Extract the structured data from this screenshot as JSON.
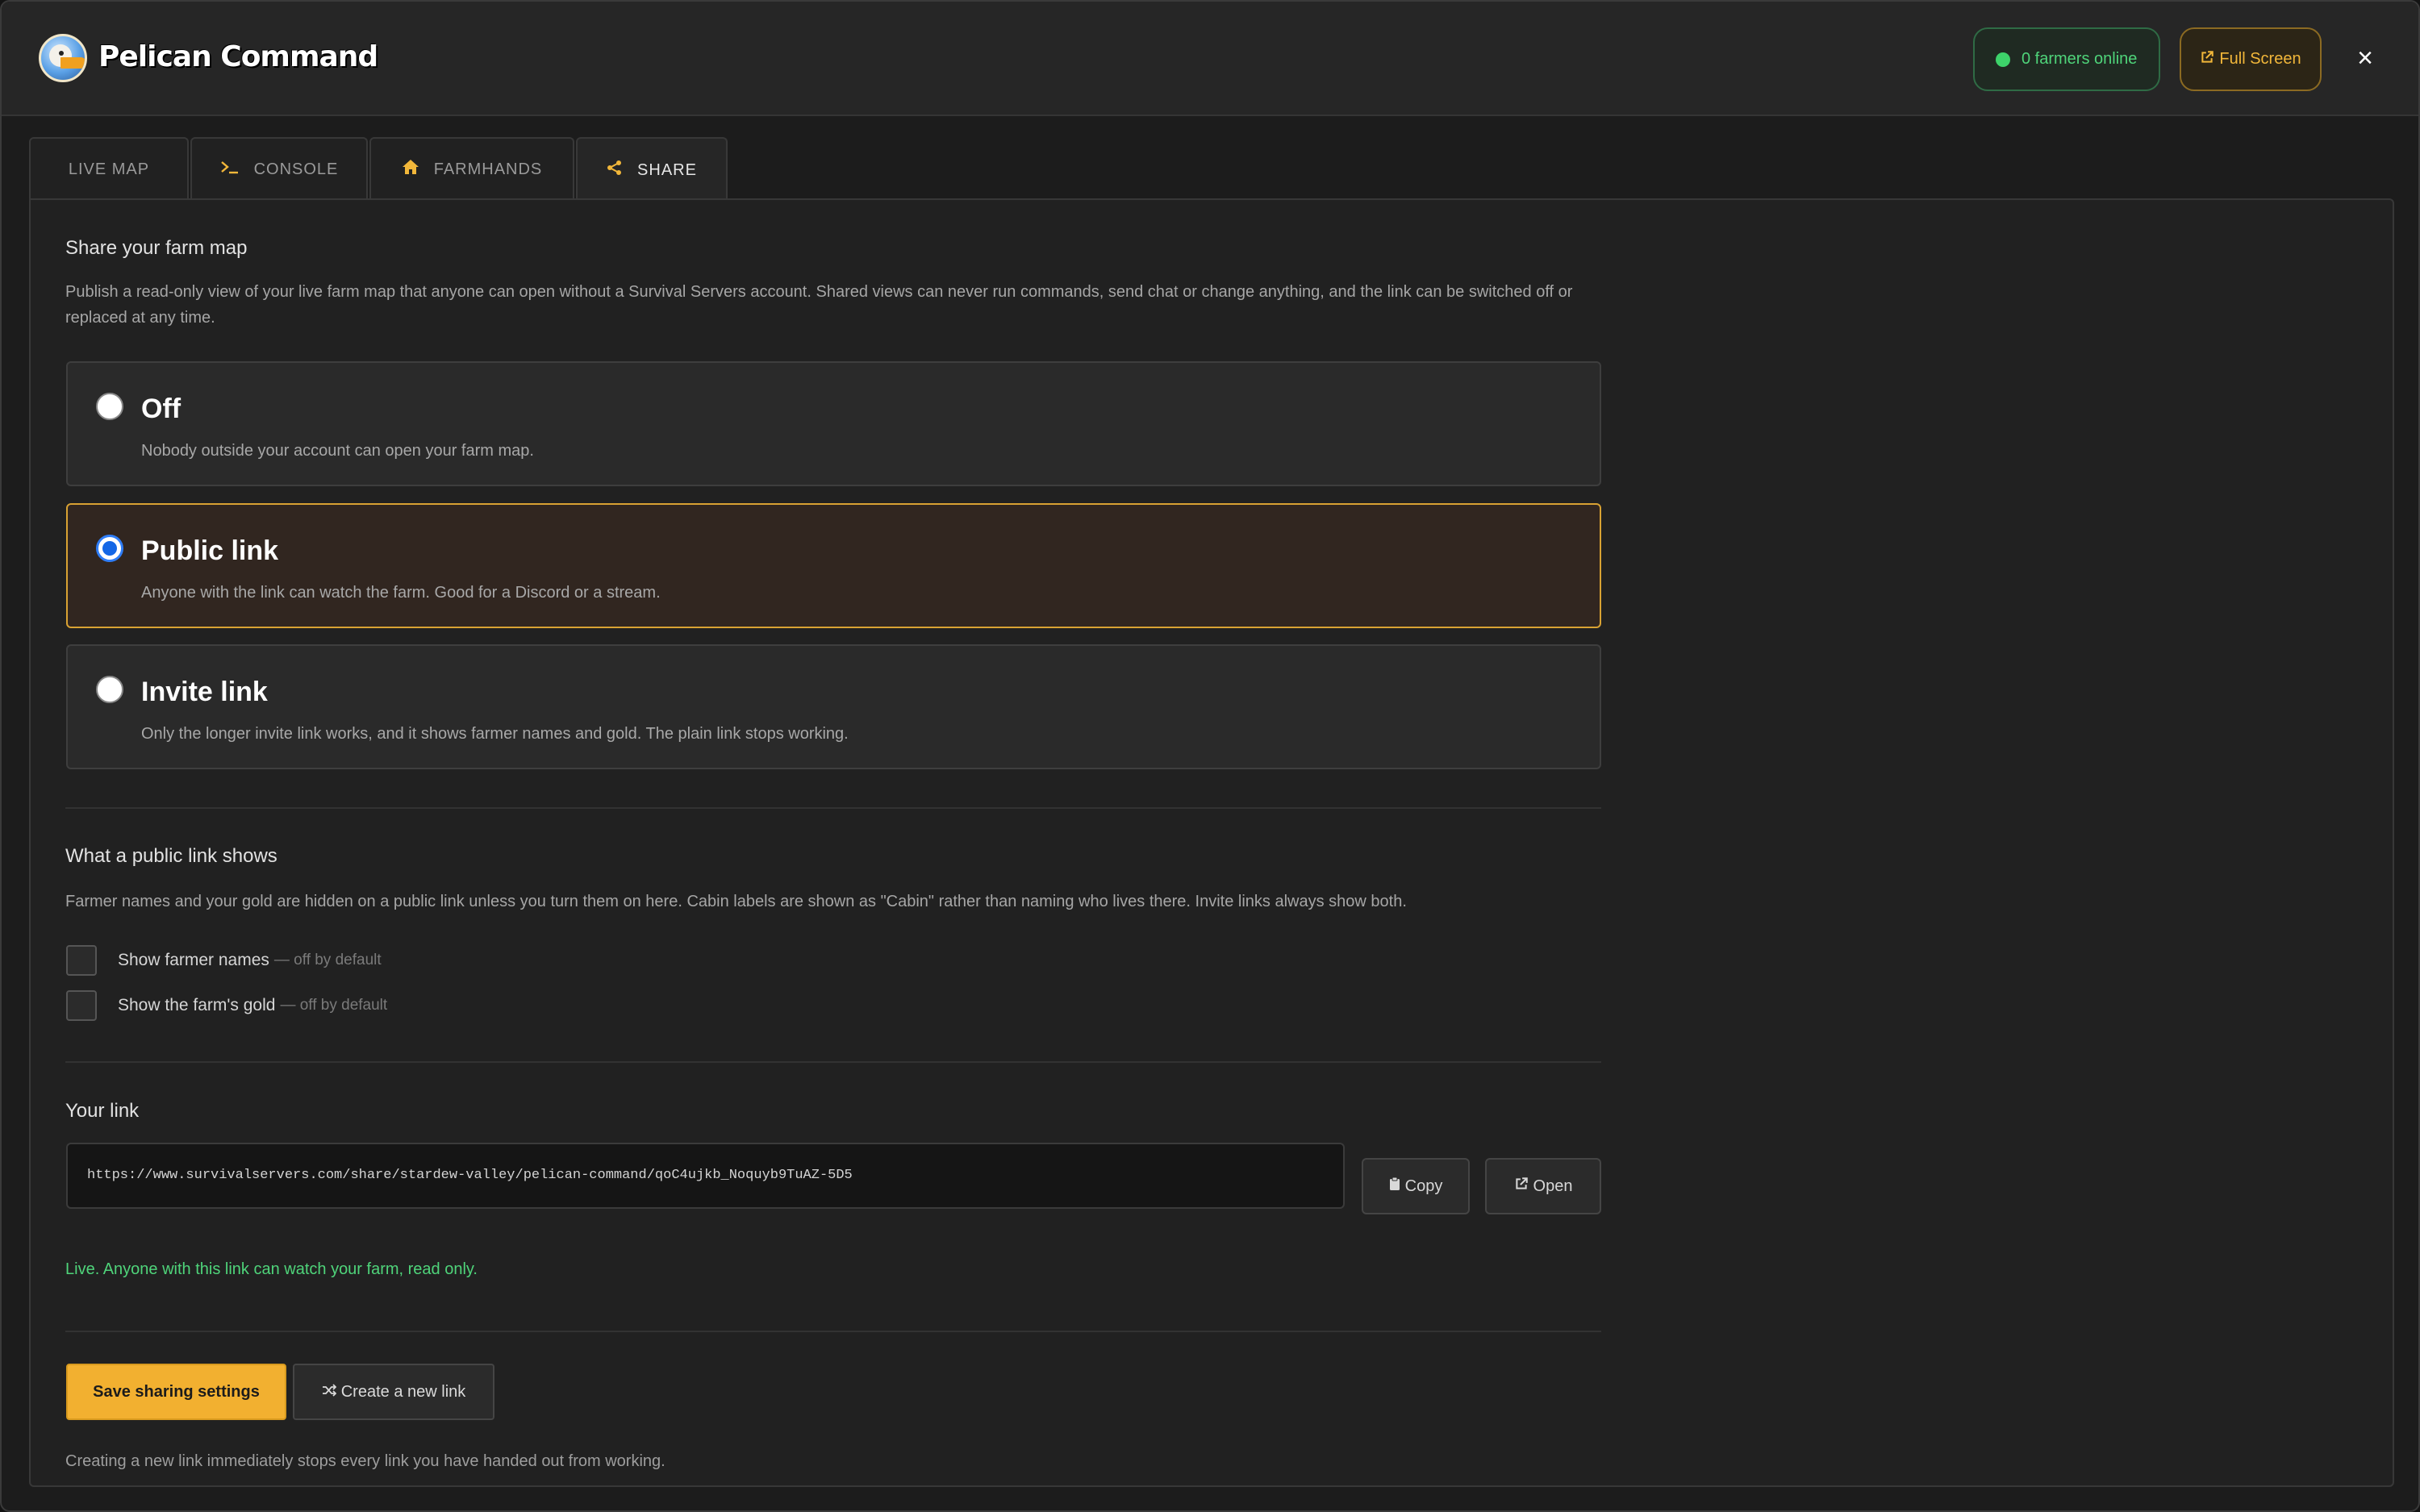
{
  "app": {
    "brand": "Pelican Command",
    "online_status": "0 farmers online",
    "fullscreen_label": "Full Screen",
    "close_symbol": "×"
  },
  "tabs": [
    {
      "label": "LIVE MAP",
      "icon": ""
    },
    {
      "label": "CONSOLE",
      "icon": "terminal-icon"
    },
    {
      "label": "FARMHANDS",
      "icon": "home-icon"
    },
    {
      "label": "SHARE",
      "icon": "share-icon",
      "active": true
    }
  ],
  "share": {
    "title": "Share your farm map",
    "description": "Publish a read-only view of your live farm map that anyone can open without a Survival Servers account. Shared views can never run commands, send chat or change anything, and the link can be switched off or replaced at any time.",
    "options": [
      {
        "title": "Off",
        "desc": "Nobody outside your account can open your farm map.",
        "selected": false
      },
      {
        "title": "Public link",
        "desc": "Anyone with the link can watch the farm. Good for a Discord or a stream.",
        "selected": true
      },
      {
        "title": "Invite link",
        "desc": "Only the longer invite link works, and it shows farmer names and gold. The plain link stops working.",
        "selected": false
      }
    ]
  },
  "public_shows": {
    "title": "What a public link shows",
    "description": "Farmer names and your gold are hidden on a public link unless you turn them on here. Cabin labels are shown as \"Cabin\" rather than naming who lives there. Invite links always show both.",
    "checks": [
      {
        "label": "Show farmer names",
        "hint": "— off by default",
        "checked": false
      },
      {
        "label": "Show the farm's gold",
        "hint": "— off by default",
        "checked": false
      }
    ]
  },
  "your_link": {
    "title": "Your link",
    "url": "https://www.survivalservers.com/share/stardew-valley/pelican-command/qoC4ujkb_Noquyb9TuAZ-5D5",
    "copy_label": "Copy",
    "open_label": "Open",
    "status": "Live. Anyone with this link can watch your farm, read only."
  },
  "actions": {
    "save_label": "Save sharing settings",
    "new_link_label": "Create a new link",
    "note": "Creating a new link immediately stops every link you have handed out from working."
  },
  "colors": {
    "accent": "#f2b030",
    "online": "#4fd47a",
    "selected_border": "#d9a233",
    "radio_on": "#1467e6"
  }
}
